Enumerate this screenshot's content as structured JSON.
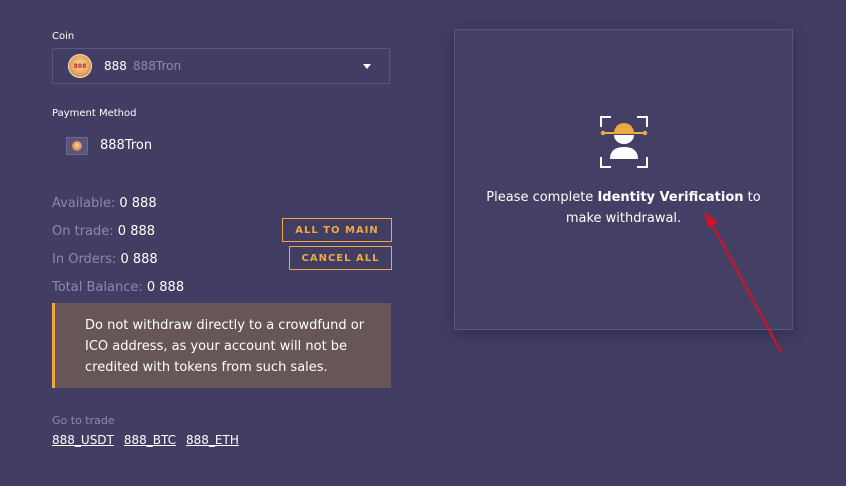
{
  "coin": {
    "label": "Coin",
    "logo_text": "888",
    "symbol": "888",
    "name": "888Tron"
  },
  "payment": {
    "label": "Payment Method",
    "name": "888Tron"
  },
  "balances": {
    "available_label": "Available:",
    "available_value": "0 888",
    "on_trade_label": "On trade:",
    "on_trade_value": "0 888",
    "in_orders_label": "In Orders:",
    "in_orders_value": "0 888",
    "total_label": "Total Balance:",
    "total_value": "0 888"
  },
  "buttons": {
    "all_to_main": "ALL TO MAIN",
    "cancel_all": "CANCEL ALL"
  },
  "warning": {
    "text": "Do not withdraw directly to a crowdfund or ICO address, as your account will not be credited with tokens from such sales."
  },
  "trade": {
    "label": "Go to trade",
    "links": [
      "888_USDT",
      "888_BTC",
      "888_ETH"
    ]
  },
  "verification": {
    "text_before": "Please complete ",
    "text_bold": "Identity Verification",
    "text_after": " to make withdrawal."
  },
  "colors": {
    "background": "#423d62",
    "accent": "#f0a842",
    "annotation_arrow": "#d4112a"
  }
}
